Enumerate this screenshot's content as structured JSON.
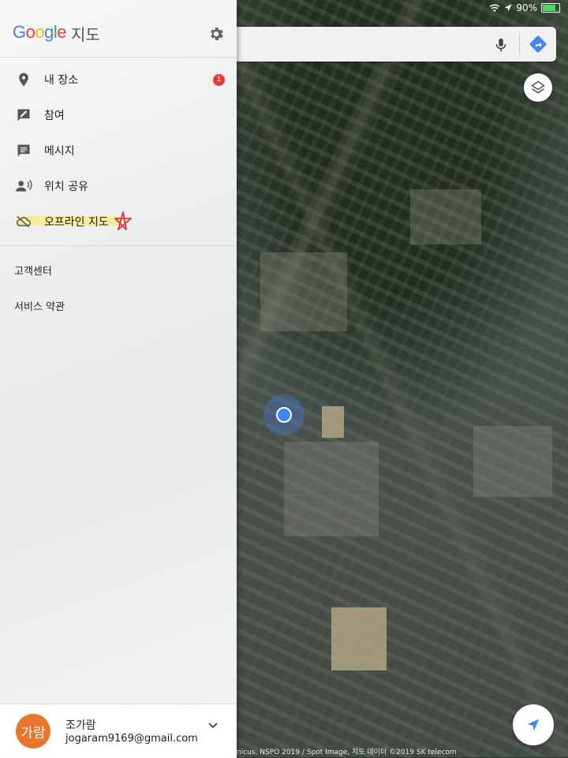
{
  "status": {
    "battery_text": "90%",
    "battery_level": 0.9
  },
  "drawer": {
    "logo_letters": [
      {
        "ch": "G",
        "color": "#4285F4"
      },
      {
        "ch": "o",
        "color": "#EA4335"
      },
      {
        "ch": "o",
        "color": "#FBBC05"
      },
      {
        "ch": "g",
        "color": "#4285F4"
      },
      {
        "ch": "l",
        "color": "#34A853"
      },
      {
        "ch": "e",
        "color": "#EA4335"
      }
    ],
    "app_suffix": "지도",
    "menu": [
      {
        "label": "내 장소",
        "icon": "pin-icon"
      },
      {
        "label": "참여",
        "icon": "contribute-icon"
      },
      {
        "label": "메시지",
        "icon": "message-icon"
      },
      {
        "label": "위치 공유",
        "icon": "location-sharing-icon"
      },
      {
        "label": "오프라인 지도",
        "icon": "offline-cloud-icon"
      }
    ],
    "badge_count": "1",
    "links": [
      "고객센터",
      "서비스 약관"
    ],
    "account": {
      "avatar_text": "가람",
      "name": "조가람",
      "email": "jogaram9169@gmail.com"
    }
  },
  "map": {
    "copyright": "nicus, NSPO 2019 / Spot Image, 지도 데이터 ©2019 SK telecom"
  },
  "colors": {
    "accent_blue": "#4285F4",
    "badge_red": "#E53935",
    "avatar_orange": "#E8772E",
    "highlight_yellow": "#F4EC9C"
  }
}
